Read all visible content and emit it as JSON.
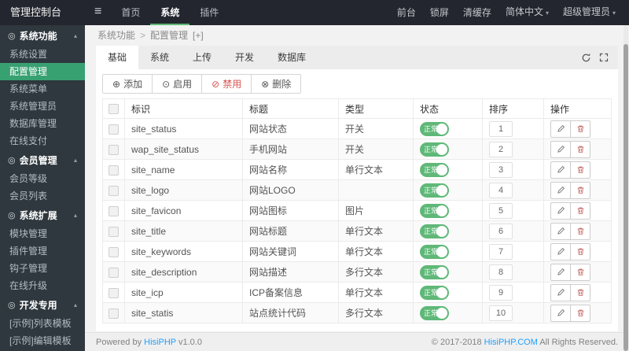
{
  "colors": {
    "accent_green": "#5FB878",
    "sidebar_active_green": "#38a172",
    "link_blue": "#1E9FFF",
    "danger_red": "#d9534f",
    "topbar_bg": "#23262e",
    "sidebar_bg": "#2f383e"
  },
  "topbar": {
    "logo": "管理控制台",
    "nav": [
      {
        "label": "首页",
        "active": false
      },
      {
        "label": "系统",
        "active": true
      },
      {
        "label": "插件",
        "active": false
      }
    ],
    "right_items": [
      {
        "label": "前台",
        "caret": false
      },
      {
        "label": "锁屏",
        "caret": false
      },
      {
        "label": "清缓存",
        "caret": false
      },
      {
        "label": "简体中文",
        "caret": true
      },
      {
        "label": "超级管理员",
        "caret": true
      }
    ]
  },
  "sidebar": {
    "sections": [
      {
        "title": "系统功能",
        "items": [
          {
            "label": "系统设置",
            "active": false
          },
          {
            "label": "配置管理",
            "active": true
          },
          {
            "label": "系统菜单",
            "active": false
          },
          {
            "label": "系统管理员",
            "active": false
          },
          {
            "label": "数据库管理",
            "active": false
          },
          {
            "label": "在线支付",
            "active": false
          }
        ]
      },
      {
        "title": "会员管理",
        "items": [
          {
            "label": "会员等级",
            "active": false
          },
          {
            "label": "会员列表",
            "active": false
          }
        ]
      },
      {
        "title": "系统扩展",
        "items": [
          {
            "label": "模块管理",
            "active": false
          },
          {
            "label": "插件管理",
            "active": false
          },
          {
            "label": "钩子管理",
            "active": false
          },
          {
            "label": "在线升级",
            "active": false
          }
        ]
      },
      {
        "title": "开发专用",
        "items": [
          {
            "label": "[示例]列表模板",
            "active": false
          },
          {
            "label": "[示例]编辑模板",
            "active": false
          }
        ]
      }
    ]
  },
  "breadcrumb": {
    "items": [
      "系统功能",
      "配置管理"
    ],
    "separator": ">",
    "suffix": "[+]"
  },
  "tabs": {
    "items": [
      "基础",
      "系统",
      "上传",
      "开发",
      "数据库"
    ],
    "active_index": 0
  },
  "toolbar": {
    "buttons": [
      {
        "label": "添加",
        "icon": "plus-circle-icon",
        "danger": false
      },
      {
        "label": "启用",
        "icon": "check-circle-icon",
        "danger": false
      },
      {
        "label": "禁用",
        "icon": "ban-circle-icon",
        "danger": true
      },
      {
        "label": "删除",
        "icon": "x-circle-icon",
        "danger": false
      }
    ]
  },
  "table": {
    "headers": [
      "标识",
      "标题",
      "类型",
      "状态",
      "排序",
      "操作"
    ],
    "rows": [
      {
        "id": "site_status",
        "title": "网站状态",
        "type": "开关",
        "status": "正常",
        "sort": "1"
      },
      {
        "id": "wap_site_status",
        "title": "手机网站",
        "type": "开关",
        "status": "正常",
        "sort": "2"
      },
      {
        "id": "site_name",
        "title": "网站名称",
        "type": "单行文本",
        "status": "正常",
        "sort": "3"
      },
      {
        "id": "site_logo",
        "title": "网站LOGO",
        "type": "",
        "status": "正常",
        "sort": "4"
      },
      {
        "id": "site_favicon",
        "title": "网站图标",
        "type": "图片",
        "status": "正常",
        "sort": "5"
      },
      {
        "id": "site_title",
        "title": "网站标题",
        "type": "单行文本",
        "status": "正常",
        "sort": "6"
      },
      {
        "id": "site_keywords",
        "title": "网站关键词",
        "type": "单行文本",
        "status": "正常",
        "sort": "7"
      },
      {
        "id": "site_description",
        "title": "网站描述",
        "type": "多行文本",
        "status": "正常",
        "sort": "8"
      },
      {
        "id": "site_icp",
        "title": "ICP备案信息",
        "type": "单行文本",
        "status": "正常",
        "sort": "9"
      },
      {
        "id": "site_statis",
        "title": "站点统计代码",
        "type": "多行文本",
        "status": "正常",
        "sort": "10"
      }
    ]
  },
  "footer": {
    "left_prefix": "Powered by ",
    "left_link": "HisiPHP",
    "left_suffix": " v1.0.0",
    "right_prefix": "© 2017-2018 ",
    "right_link": "HisiPHP.COM",
    "right_suffix": " All Rights Reserved."
  }
}
